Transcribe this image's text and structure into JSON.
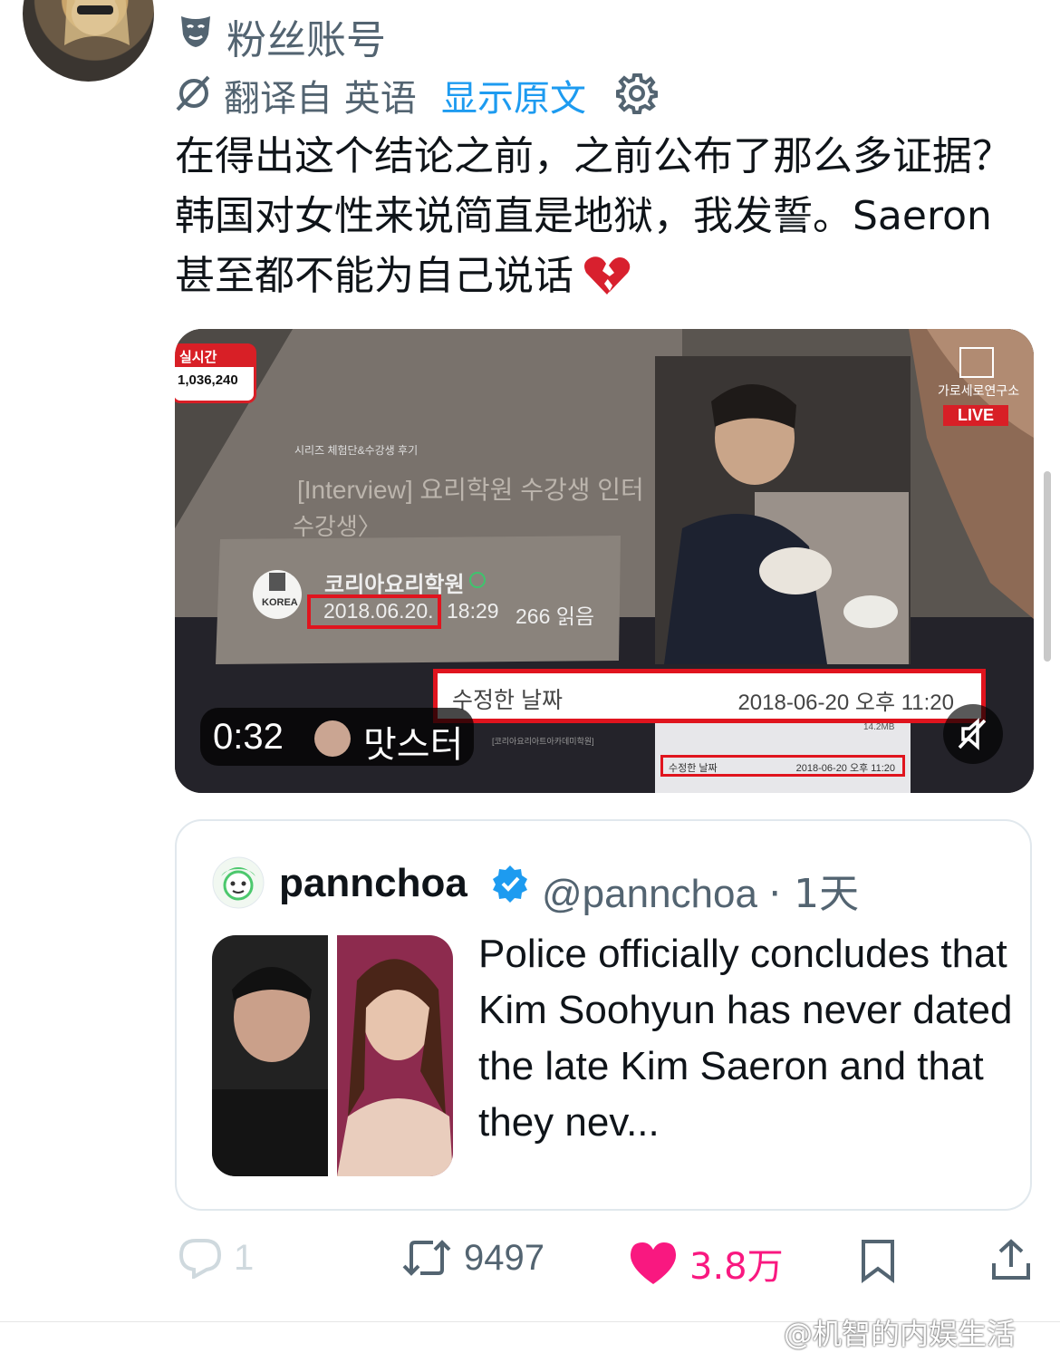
{
  "header": {
    "account_name": "粉丝账号",
    "translate_label": "翻译自 英语",
    "show_original": "显示原文"
  },
  "tweet": {
    "text": "在得出这个结论之前，之前公布了那么多证据？韩国对女性来说简直是地狱，我发誓。Saeron 甚至都不能为自己说话"
  },
  "video": {
    "live_count_label": "실시간",
    "live_count": "1,036,240",
    "channel_name": "가로세로연구소",
    "live_badge": "LIVE",
    "post_category": "시리즈 체험단&수강생 후기",
    "post_title": "[Interview] 요리학원 수강생 인터",
    "post_title_2": "수강생〉",
    "org_name": "코리아요리학원",
    "org_logo_text": "KOREA",
    "post_date": "2018.06.20.",
    "post_time": "18:29",
    "post_reads": "266 읽음",
    "modified_label": "수정한 날짜",
    "modified_value": "2018-06-20 오후 11:20",
    "small_size": "14.2MB",
    "small_modified_label": "수정한 날짜",
    "small_modified_value": "2018-06-20 오후 11:20",
    "small_source": "[코리아요리아트아카데미학원]",
    "duration": "0:32",
    "uploader": "맛스터"
  },
  "quote": {
    "name": "pannchoa",
    "handle": "@pannchoa",
    "time": "· 1天",
    "text": "Police officially concludes that Kim Soohyun has never dated the late Kim Saeron and that they nev..."
  },
  "actions": {
    "reply_count": "1",
    "retweet_count": "9497",
    "like_count": "3.8万"
  },
  "watermark": "@机智的内娱生活",
  "colors": {
    "link": "#1d9bf0",
    "like": "#f91880",
    "secondary": "#536471",
    "highlight_box": "#e0141e"
  }
}
